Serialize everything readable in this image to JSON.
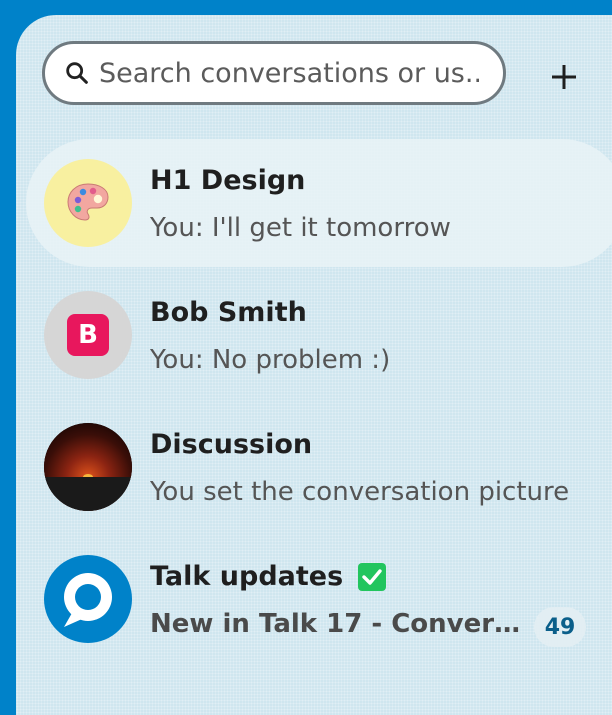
{
  "search": {
    "placeholder": "Search conversations or us..."
  },
  "add_button": {
    "label": "+",
    "icon": "plus-icon"
  },
  "conversations": [
    {
      "name": "H1 Design",
      "last_message": "You: I'll get it tomorrow",
      "avatar": "palette-icon",
      "active": true
    },
    {
      "name": "Bob Smith",
      "last_message": "You: No problem :)",
      "avatar": "bob-avatar",
      "avatar_letter": "B"
    },
    {
      "name": "Discussion",
      "last_message": "You set the conversation picture",
      "avatar": "sunset-image"
    },
    {
      "name": "Talk updates",
      "name_icon": "check-mark-icon",
      "last_message": "New in Talk 17 - Convers...",
      "unread_count": "49",
      "avatar": "talk-logo-icon"
    }
  ],
  "colors": {
    "accent": "#0082c9",
    "panel_bg": "#cfe6ef",
    "active_row": "#e9f2f6",
    "bob_badge": "#e8175d",
    "check_green": "#22c55e"
  }
}
